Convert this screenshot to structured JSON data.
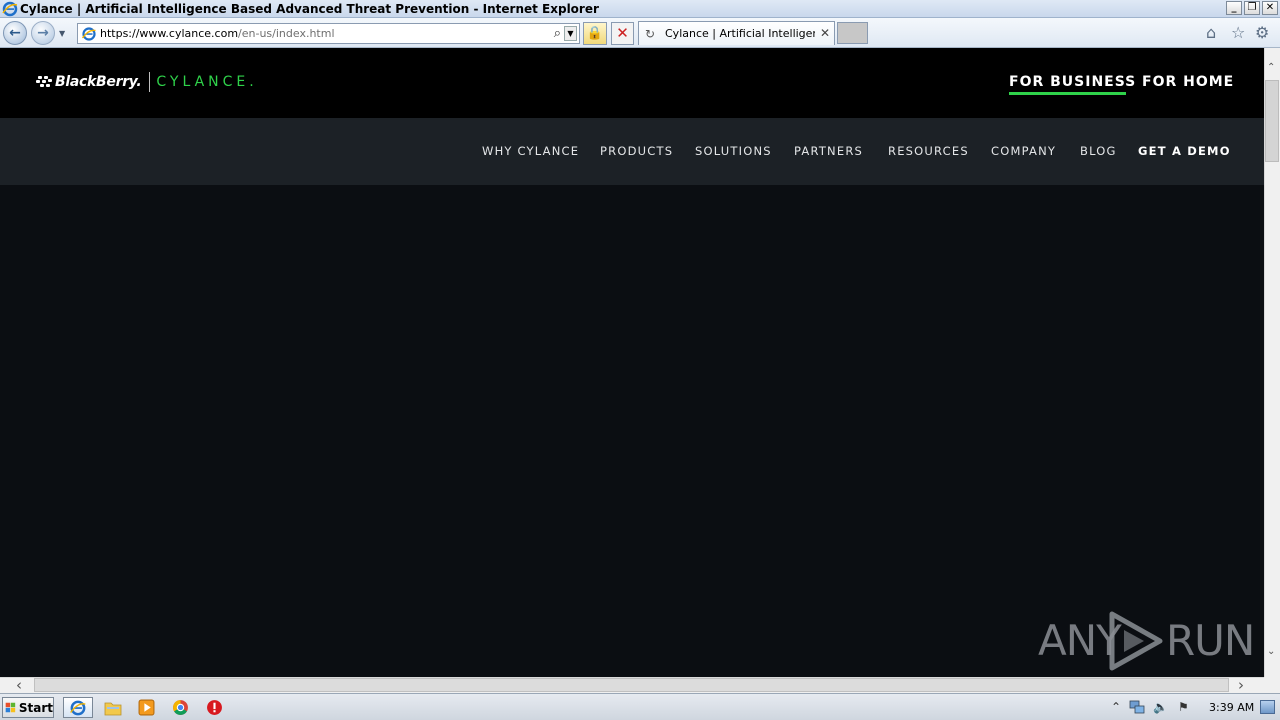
{
  "window": {
    "title": "Cylance | Artificial Intelligence Based Advanced Threat Prevention - Internet Explorer",
    "min": "_",
    "max": "❐",
    "close": "✕"
  },
  "browser": {
    "back": "←",
    "forward": "→",
    "nav_dropdown": "▼",
    "url_host": "https://www.cylance.com",
    "url_path": "/en-us/index.html",
    "search_glyph": "⌕",
    "addr_dropdown": "▼",
    "lock_glyph": "🔒",
    "stop_glyph": "✕",
    "tab_label": "Cylance | Artificial Intelligenc...",
    "tab_spinner": "↻",
    "tab_close": "✕",
    "home_glyph": "⌂",
    "favorites_glyph": "☆",
    "tools_glyph": "⚙"
  },
  "site": {
    "brand_bb": "BlackBerry.",
    "brand_cylance": "CYLANCE.",
    "top_links": {
      "business": "FOR BUSINESS",
      "home": "FOR HOME"
    },
    "nav": {
      "why": "WHY CYLANCE",
      "products": "PRODUCTS",
      "solutions": "SOLUTIONS",
      "partners": "PARTNERS",
      "resources": "RESOURCES",
      "company": "COMPANY",
      "blog": "BLOG",
      "demo": "GET A DEMO"
    },
    "accent_color": "#2fd24a"
  },
  "scroll": {
    "up": "⌃",
    "down": "⌄",
    "left": "‹",
    "right": "›"
  },
  "watermark": {
    "left": "ANY",
    "right": "RUN"
  },
  "taskbar": {
    "start_label": "Start",
    "tray_up": "⌃",
    "volume_glyph": "🔈",
    "flag_glyph": "⚑",
    "clock": "3:39 AM"
  }
}
